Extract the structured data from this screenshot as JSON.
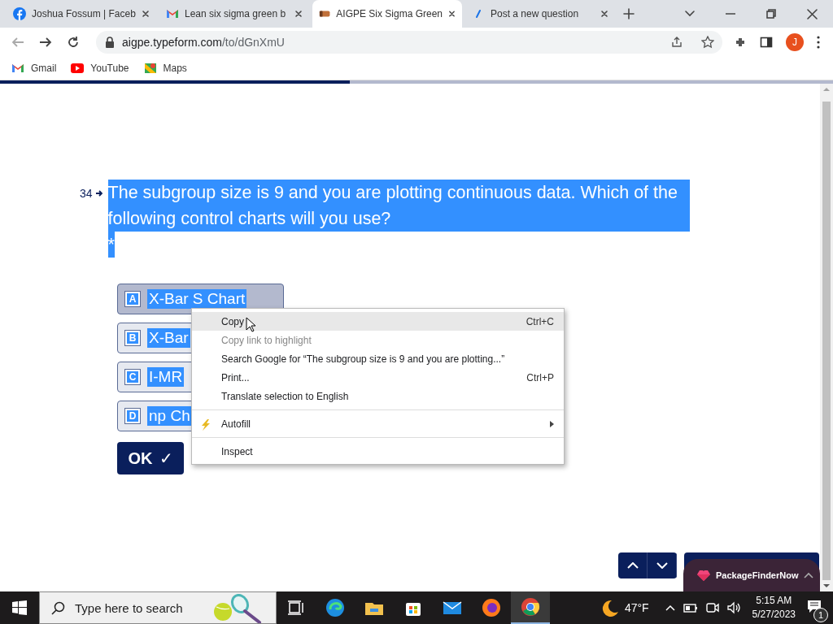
{
  "browser": {
    "tabs": [
      {
        "title": "Joshua Fossum | Faceb",
        "selected": false
      },
      {
        "title": "Lean six sigma green b",
        "selected": false
      },
      {
        "title": "AIGPE Six Sigma Green",
        "selected": true
      },
      {
        "title": "Post a new question",
        "selected": false
      }
    ],
    "address": {
      "host": "aigpe.typeform.com",
      "path": "/to/dGnXmU"
    },
    "profile_letter": "J",
    "bookmarks": [
      {
        "label": "Gmail"
      },
      {
        "label": "YouTube"
      },
      {
        "label": "Maps"
      }
    ]
  },
  "progress": {
    "level": 0.42
  },
  "question": {
    "number": "34",
    "text": "The subgroup size is 9 and you are plotting continuous data. Which of the following control charts will you use?",
    "required_mark": "*"
  },
  "choices": [
    {
      "key": "A",
      "label": "X-Bar S Chart",
      "selected": true
    },
    {
      "key": "B",
      "label": "X-Bar",
      "selected": false
    },
    {
      "key": "C",
      "label": "I-MR",
      "selected": false
    },
    {
      "key": "D",
      "label": "np Ch",
      "selected": false
    }
  ],
  "ok_button": {
    "label": "OK",
    "icon": "✓"
  },
  "promo": {
    "label": "PackageFinderNow"
  },
  "context_menu": {
    "items": [
      {
        "kind": "item",
        "label": "Copy",
        "shortcut": "Ctrl+C",
        "highlighted": true,
        "disabled": false
      },
      {
        "kind": "item",
        "label": "Copy link to highlight",
        "highlighted": false,
        "disabled": true
      },
      {
        "kind": "item",
        "label": "Search Google for “The subgroup size is 9 and you are plotting...”",
        "highlighted": false,
        "disabled": false
      },
      {
        "kind": "item",
        "label": "Print...",
        "shortcut": "Ctrl+P",
        "highlighted": false,
        "disabled": false
      },
      {
        "kind": "item",
        "label": "Translate selection to English",
        "highlighted": false,
        "disabled": false
      },
      {
        "kind": "separator"
      },
      {
        "kind": "submenu",
        "label": "Autofill",
        "highlighted": false,
        "disabled": false
      },
      {
        "kind": "separator"
      },
      {
        "kind": "item",
        "label": "Inspect",
        "highlighted": false,
        "disabled": false
      }
    ]
  },
  "taskbar": {
    "search_placeholder": "Type here to search",
    "weather": "47°F",
    "time": "5:15 AM",
    "date": "5/27/2023",
    "notifications": "1"
  }
}
